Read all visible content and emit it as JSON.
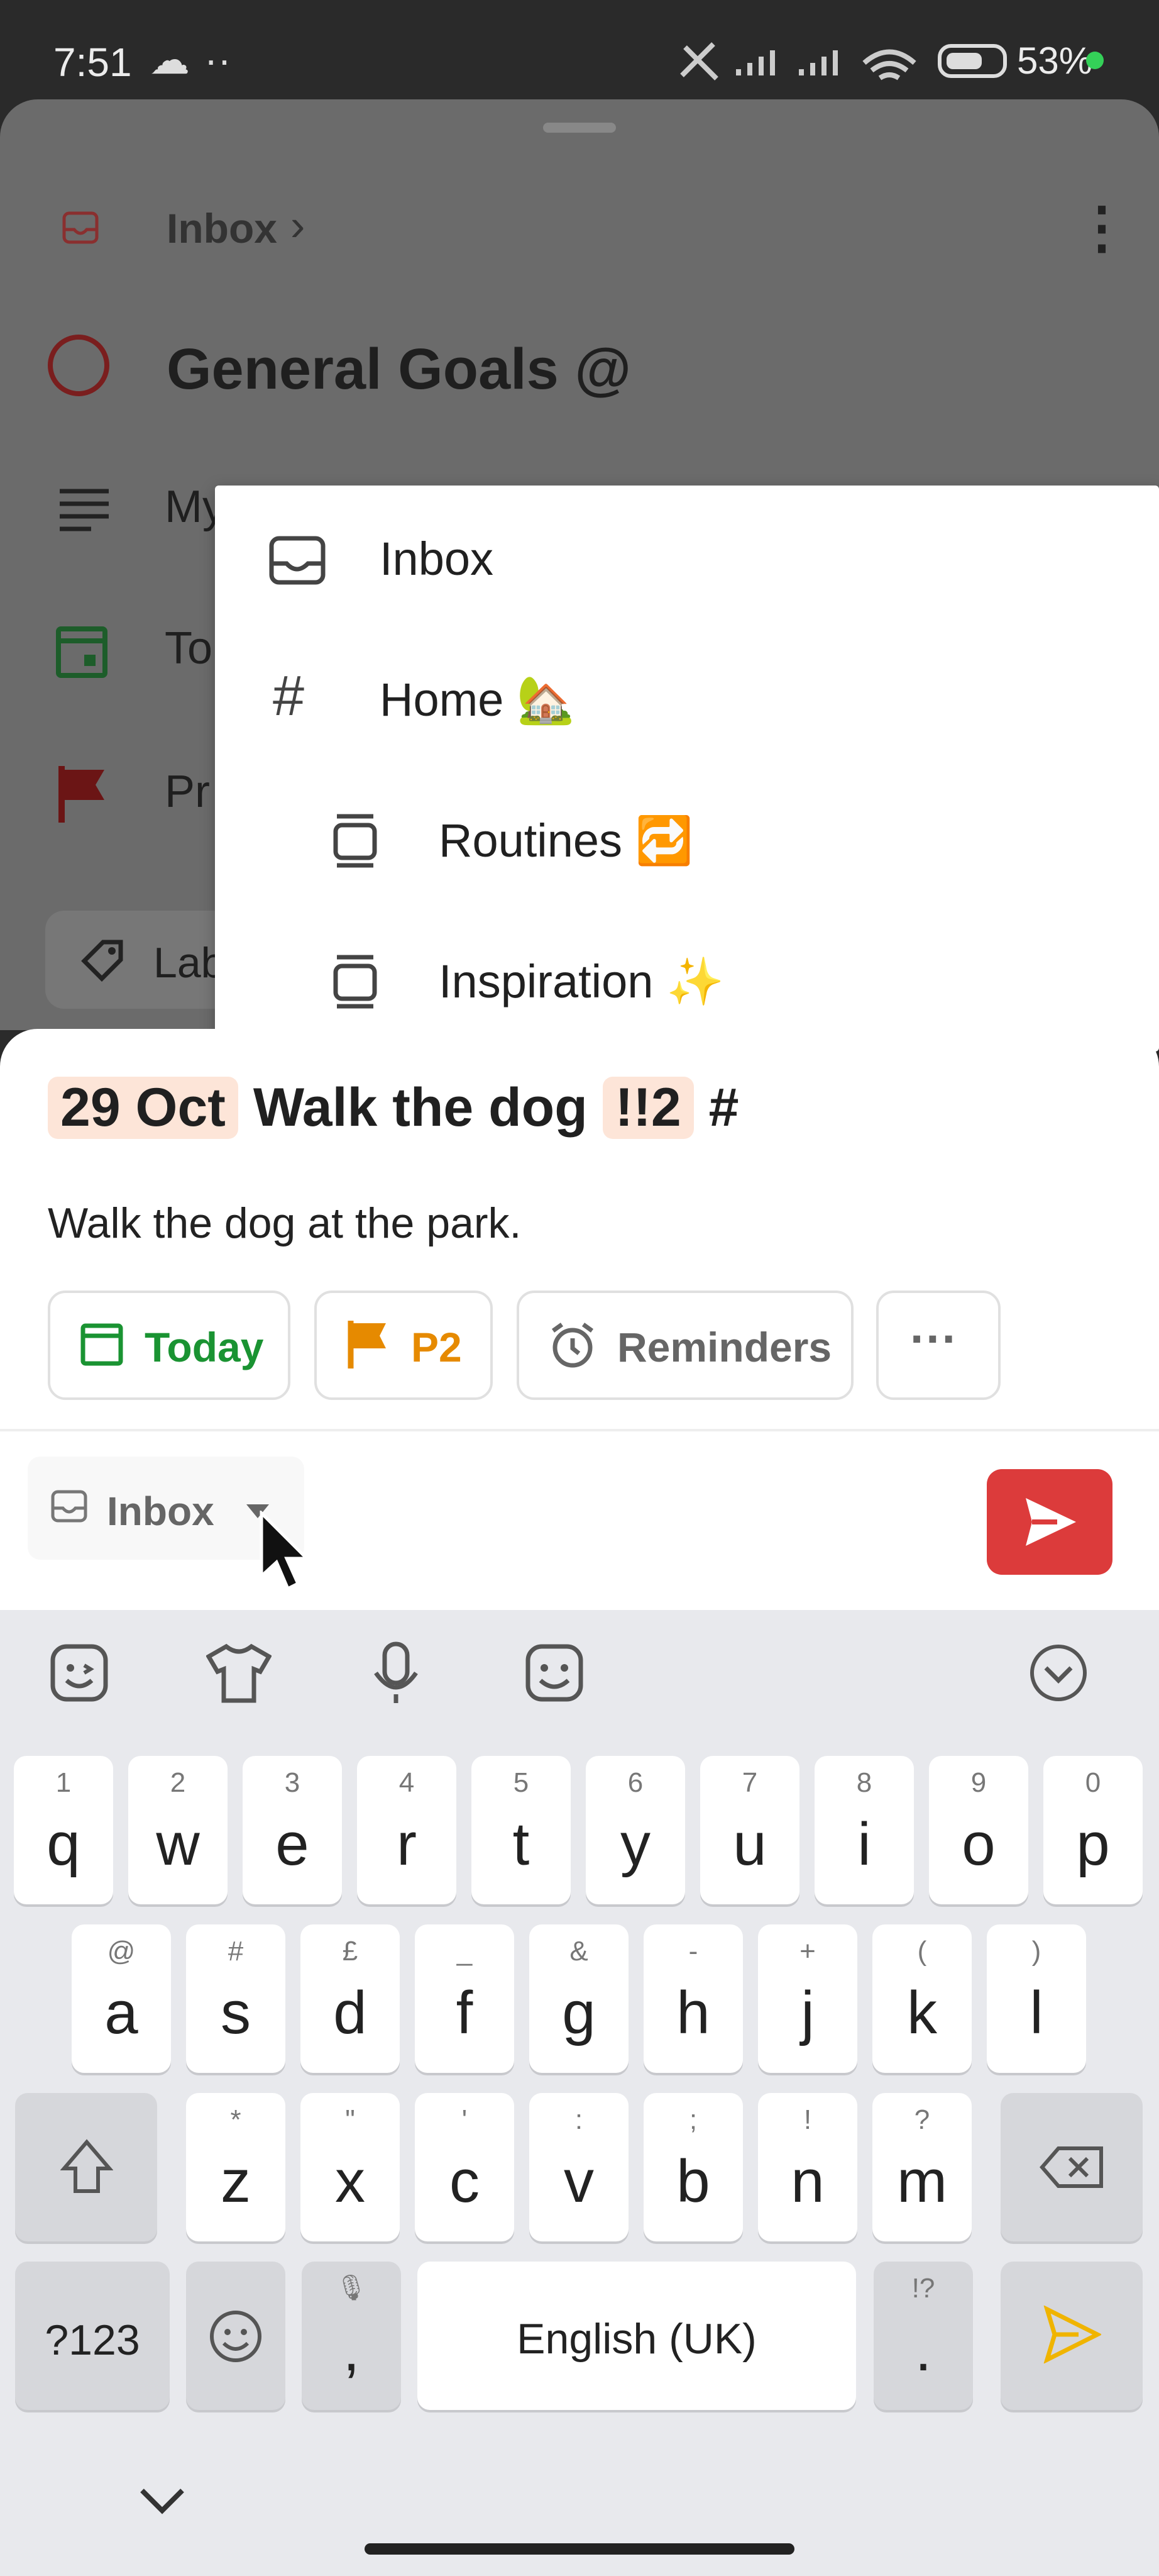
{
  "status_bar": {
    "time": "7:51",
    "cloud": "☁",
    "dots": "··",
    "battery_percent": "53%"
  },
  "header": {
    "breadcrumb": "Inbox",
    "breadcrumb_chevron": "›",
    "more": "⋮"
  },
  "task": {
    "title": "General Goals @"
  },
  "background_rows": {
    "description_prefix": "My",
    "date_prefix": "To",
    "priority_prefix": "Pr",
    "labels_prefix": "Lab"
  },
  "dropdown": {
    "items": [
      {
        "label": "Inbox",
        "icon": "inbox-icon"
      },
      {
        "label": "Home 🏡",
        "icon": "hash-icon"
      },
      {
        "label": "Routines 🔁",
        "icon": "section-icon"
      },
      {
        "label": "Inspiration ✨",
        "icon": "section-icon"
      }
    ]
  },
  "compose": {
    "date_token": "29 Oct",
    "title_text": "Walk the dog",
    "priority_token": "!!2",
    "hash": "#",
    "description": "Walk the dog at the park.",
    "chips": {
      "today": "Today",
      "priority": "P2",
      "reminders": "Reminders",
      "more": "···"
    },
    "project": "Inbox"
  },
  "keyboard": {
    "toolbar": [
      "sticker-icon",
      "shirt-icon",
      "mic-icon",
      "emoji-icon",
      "collapse-icon"
    ],
    "row1": [
      {
        "k": "q",
        "h": "1"
      },
      {
        "k": "w",
        "h": "2"
      },
      {
        "k": "e",
        "h": "3"
      },
      {
        "k": "r",
        "h": "4"
      },
      {
        "k": "t",
        "h": "5"
      },
      {
        "k": "y",
        "h": "6"
      },
      {
        "k": "u",
        "h": "7"
      },
      {
        "k": "i",
        "h": "8"
      },
      {
        "k": "o",
        "h": "9"
      },
      {
        "k": "p",
        "h": "0"
      }
    ],
    "row2": [
      {
        "k": "a",
        "h": "@"
      },
      {
        "k": "s",
        "h": "#"
      },
      {
        "k": "d",
        "h": "£"
      },
      {
        "k": "f",
        "h": "_"
      },
      {
        "k": "g",
        "h": "&"
      },
      {
        "k": "h",
        "h": "-"
      },
      {
        "k": "j",
        "h": "+"
      },
      {
        "k": "k",
        "h": "("
      },
      {
        "k": "l",
        "h": ")"
      }
    ],
    "row3": [
      {
        "k": "z",
        "h": "*"
      },
      {
        "k": "x",
        "h": "\""
      },
      {
        "k": "c",
        "h": "'"
      },
      {
        "k": "v",
        "h": ":"
      },
      {
        "k": "b",
        "h": ";"
      },
      {
        "k": "n",
        "h": "!"
      },
      {
        "k": "m",
        "h": "?"
      }
    ],
    "symbols": "?123",
    "comma": ",",
    "space": "English (UK)",
    "period": ".",
    "period_hint": "!?"
  }
}
